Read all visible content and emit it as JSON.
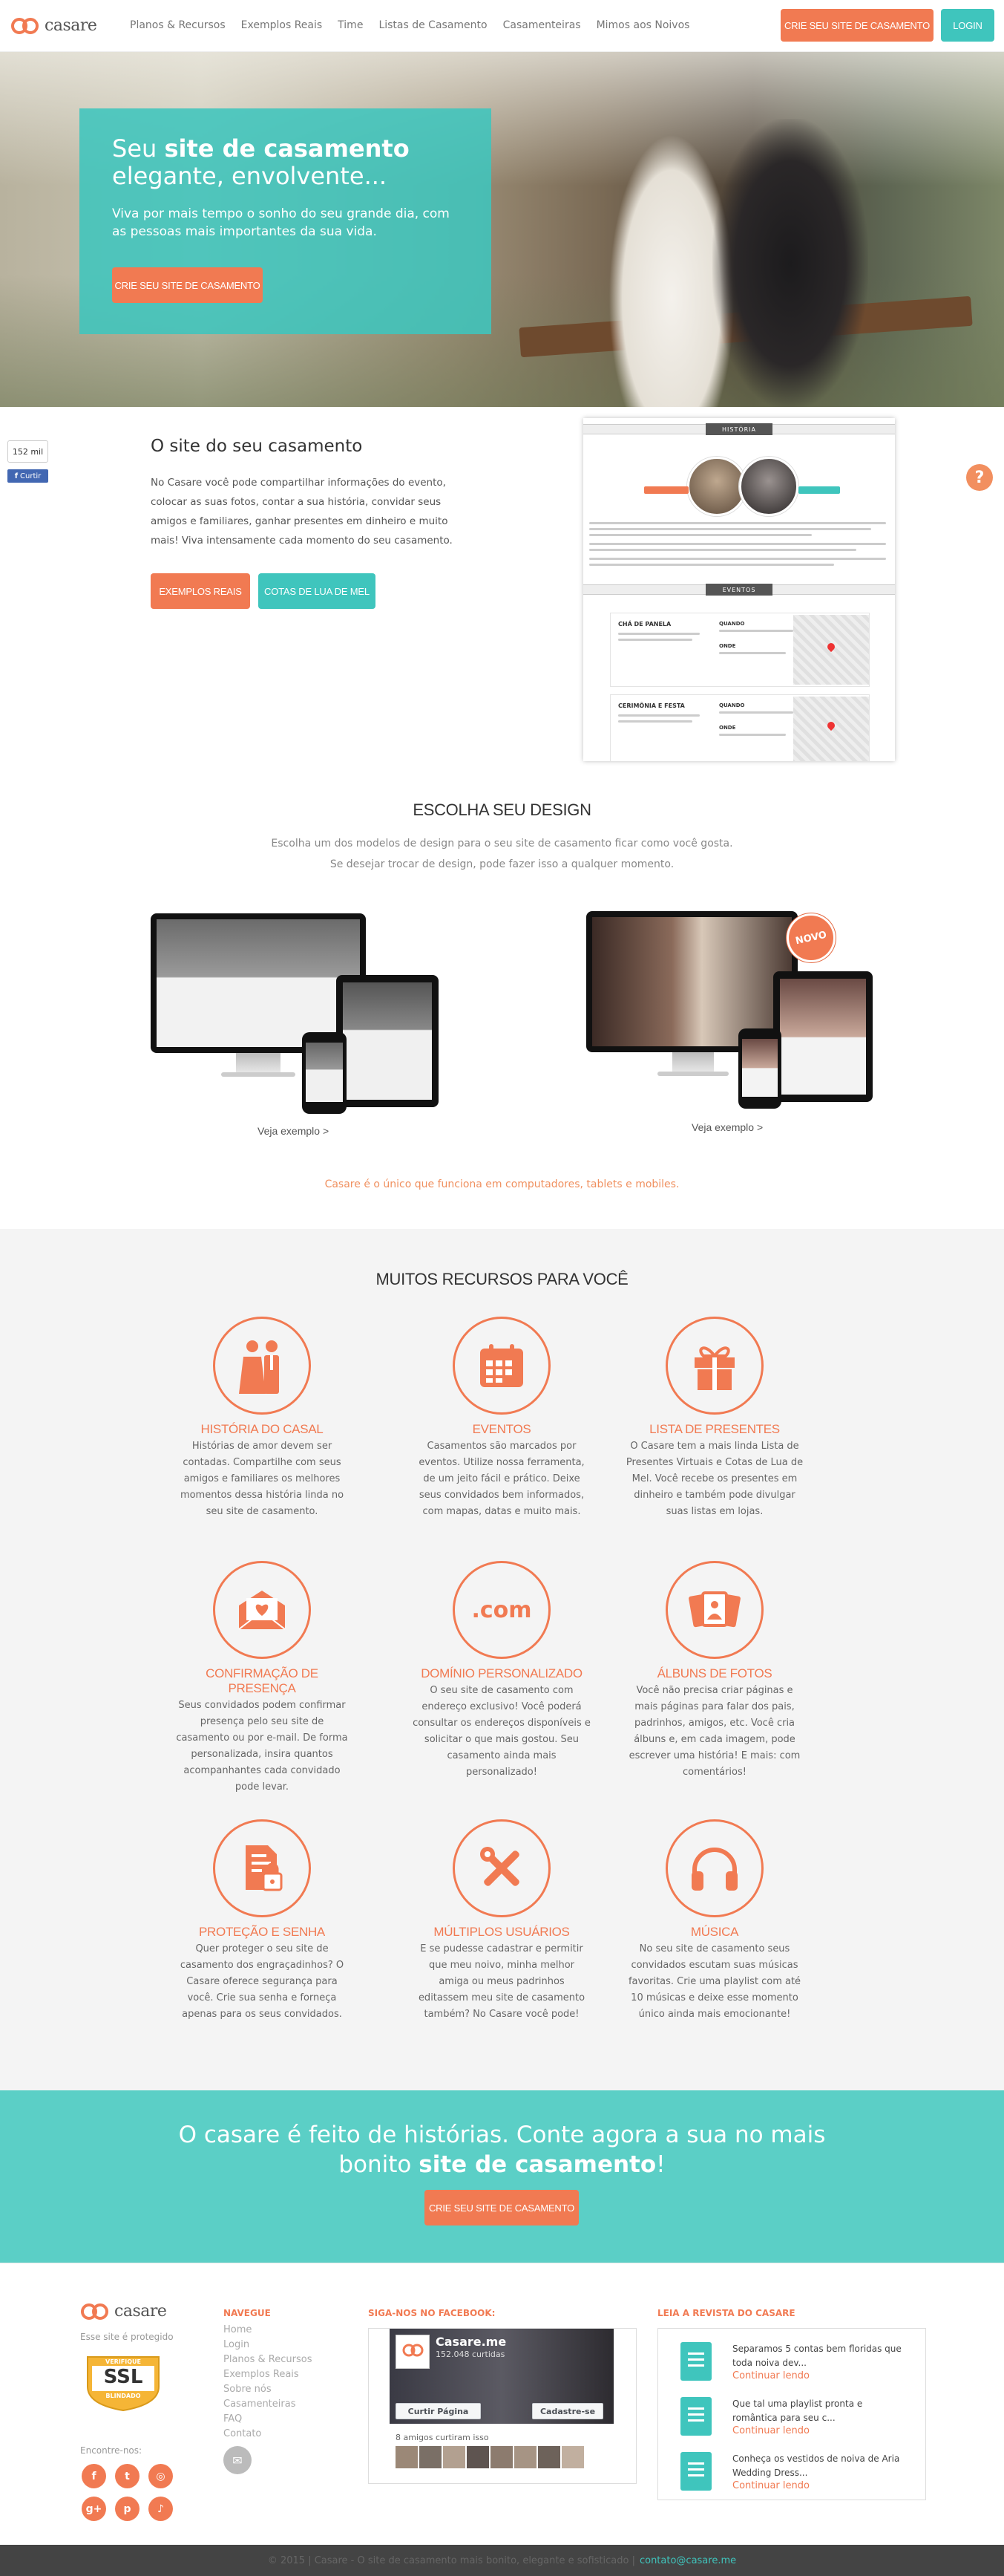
{
  "brand": {
    "name": "casare",
    "color": "#f17a52",
    "accent": "#3fc5bd"
  },
  "header": {
    "nav": [
      "Planos & Recursos",
      "Exemplos Reais",
      "Time",
      "Listas de Casamento",
      "Casamenteiras",
      "Mimos aos Noivos"
    ],
    "cta_label": "CRIE SEU SITE DE CASAMENTO",
    "login_label": "LOGIN"
  },
  "hero": {
    "title_pre": "Seu ",
    "title_bold": "site de casamento",
    "title_post": "elegante, envolvente...",
    "text": "Viva por mais tempo o sonho do seu grande dia, com as pessoas mais importantes da sua vida.",
    "button": "CRIE SEU SITE DE CASAMENTO"
  },
  "social": {
    "count": "152 mil",
    "like": "Curtir"
  },
  "intro": {
    "title": "O site do seu casamento",
    "text": "No Casare você pode compartilhar informações do evento, colocar as suas fotos, contar a sua história, convidar seus amigos e familiares, ganhar presentes em dinheiro e muito mais! Viva intensamente cada momento do seu casamento.",
    "btn_examples": "EXEMPLOS REAIS",
    "btn_quotas": "COTAS DE LUA DE MEL",
    "mock": {
      "history_tag": "HISTÓRIA",
      "events_tag": "EVENTOS",
      "event1": "CHÁ DE PANELA",
      "event2": "CERIMÔNIA E FESTA",
      "when": "QUANDO",
      "where": "ONDE"
    }
  },
  "help_icon": "?",
  "design": {
    "title": "ESCOLHA SEU DESIGN",
    "sub1": "Escolha um dos modelos de design para o seu site de casamento ficar como você gosta.",
    "sub2": "Se desejar trocar de design, pode fazer isso a qualquer momento.",
    "example_link": "Veja exemplo >",
    "badge": "NOVO",
    "note": "Casare é o único que funciona em computadores, tablets e mobiles."
  },
  "features": {
    "title": "MUITOS RECURSOS PARA VOCÊ",
    "items": [
      {
        "icon": "couple-icon",
        "title": "HISTÓRIA DO CASAL",
        "text": "Histórias de amor devem ser contadas. Compartilhe com seus amigos e familiares os melhores momentos dessa história linda no seu site de casamento."
      },
      {
        "icon": "calendar-icon",
        "title": "EVENTOS",
        "text": "Casamentos são marcados por eventos. Utilize nossa ferramenta, de um jeito fácil e prático. Deixe seus convidados bem informados, com mapas, datas e muito mais."
      },
      {
        "icon": "gift-icon",
        "title": "LISTA DE PRESENTES",
        "text": "O Casare tem a mais linda Lista de Presentes Virtuais e Cotas de Lua de Mel. Você recebe os presentes em dinheiro e também pode divulgar suas listas em lojas."
      },
      {
        "icon": "envelope-heart-icon",
        "title": "CONFIRMAÇÃO DE PRESENÇA",
        "text": "Seus convidados podem confirmar presença pelo seu site de casamento ou por e-mail. De forma personalizada, insira quantos acompanhantes cada convidado pode levar."
      },
      {
        "icon": "dotcom-icon",
        "title": "DOMÍNIO PERSONALIZADO",
        "text": "O seu site de casamento com endereço exclusivo! Você poderá consultar os endereços disponíveis e solicitar o que mais gostou. Seu casamento ainda mais personalizado!"
      },
      {
        "icon": "photo-album-icon",
        "title": "ÁLBUNS DE FOTOS",
        "text": "Você não precisa criar páginas e mais páginas para falar dos pais, padrinhos, amigos, etc. Você cria álbuns e, em cada imagem, pode escrever uma história! E mais: com comentários!"
      },
      {
        "icon": "lock-document-icon",
        "title": "PROTEÇÃO E SENHA",
        "text": "Quer proteger o seu site de casamento dos engraçadinhos? O Casare oferece segurança para você. Crie sua senha e forneça apenas para os seus convidados."
      },
      {
        "icon": "tools-icon",
        "title": "MÚLTIPLOS USUÁRIOS",
        "text": "E se pudesse cadastrar e permitir que meu noivo, minha melhor amiga ou meus padrinhos editassem meu site de casamento também? No Casare você pode!"
      },
      {
        "icon": "headphones-icon",
        "title": "MÚSICA",
        "text": "No seu site de casamento seus convidados escutam suas músicas favoritas. Crie uma playlist com até 10 músicas e deixe esse momento único ainda mais emocionante!"
      }
    ]
  },
  "cta": {
    "line1": "O casare é feito de histórias. Conte agora a sua no mais",
    "line2_pre": "bonito ",
    "line2_bold": "site de casamento",
    "line2_post": "!",
    "button": "CRIE SEU SITE DE CASAMENTO"
  },
  "footer": {
    "protected": "Esse site é protegido",
    "ssl_top": "VERIFIQUE",
    "ssl": "SSL",
    "ssl_bottom": "BLINDADO",
    "find_us": "Encontre-nos:",
    "navigate_title": "NAVEGUE",
    "navigate": [
      "Home",
      "Login",
      "Planos & Recursos",
      "Exemplos Reais",
      "Sobre nós",
      "Casamenteiras",
      "FAQ",
      "Contato"
    ],
    "facebook_title": "SIGA-NOS NO FACEBOOK:",
    "fb_page": "Casare.me",
    "fb_likes": "152.048 curtidas",
    "fb_like_btn": "Curtir Página",
    "fb_share_btn": "Cadastre-se",
    "fb_friends": "8 amigos curtiram isso",
    "magazine_title": "LEIA A REVISTA DO CASARE",
    "articles": [
      {
        "title": "Separamos 5 contas bem floridas que toda noiva dev...",
        "more": "Continuar lendo"
      },
      {
        "title": "Que tal uma playlist pronta e romântica para seu c...",
        "more": "Continuar lendo"
      },
      {
        "title": "Conheça os vestidos de noiva de Aria Wedding Dress...",
        "more": "Continuar lendo"
      }
    ]
  },
  "bottom": {
    "copyright": "© 2015 | Casare - O site de casamento mais bonito, elegante e sofisticado |",
    "email": "contato@casare.me"
  }
}
